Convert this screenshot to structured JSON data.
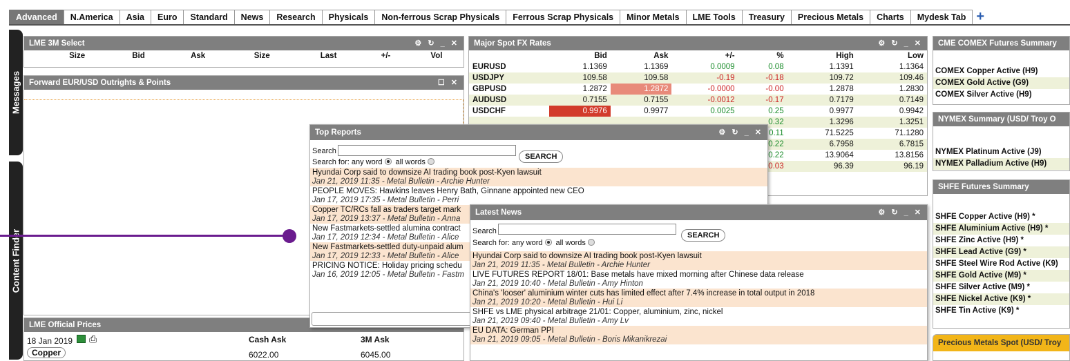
{
  "tabs": [
    "Advanced",
    "N.America",
    "Asia",
    "Euro",
    "Standard",
    "News",
    "Research",
    "Physicals",
    "Non-ferrous Scrap Physicals",
    "Ferrous Scrap Physicals",
    "Minor Metals",
    "LME Tools",
    "Treasury",
    "Precious Metals",
    "Charts",
    "Mydesk Tab"
  ],
  "tab_add": "+",
  "sidebar": {
    "messages": "Messages",
    "content_finder": "Content Finder"
  },
  "lme3m": {
    "title": "LME 3M Select",
    "columns": [
      "Size",
      "Bid",
      "Ask",
      "Size",
      "Last",
      "+/-",
      "Vol"
    ]
  },
  "forward": {
    "title": "Forward EUR/USD Outrights & Points"
  },
  "official": {
    "title": "LME Official Prices",
    "date": "18 Jan 2019",
    "col_cash": "Cash Ask",
    "col_3m": "3M Ask",
    "row_metal": "Copper",
    "row_cash": "6022.00",
    "row_3m": "6045.00"
  },
  "fx": {
    "title": "Major Spot FX Rates",
    "headers": [
      "",
      "Bid",
      "Ask",
      "+/-",
      "%",
      "High",
      "Low"
    ],
    "rows": [
      [
        "EURUSD",
        "1.1369",
        "1.1369",
        "0.0009",
        "0.08",
        "1.1391",
        "1.1364"
      ],
      [
        "USDJPY",
        "109.58",
        "109.58",
        "-0.19",
        "-0.18",
        "109.72",
        "109.46"
      ],
      [
        "GBPUSD",
        "1.2872",
        "1.2872",
        "-0.0000",
        "-0.00",
        "1.2878",
        "1.2830"
      ],
      [
        "AUDUSD",
        "0.7155",
        "0.7155",
        "-0.0012",
        "-0.17",
        "0.7179",
        "0.7149"
      ],
      [
        "USDCHF",
        "0.9976",
        "0.9977",
        "0.0025",
        "0.25",
        "0.9977",
        "0.9942"
      ],
      [
        "",
        "",
        "",
        "",
        "0.32",
        "1.3296",
        "1.3251"
      ],
      [
        "",
        "",
        "",
        "",
        "0.11",
        "71.5225",
        "71.1280"
      ],
      [
        "",
        "",
        "",
        "",
        "0.22",
        "6.7958",
        "6.7815"
      ],
      [
        "",
        "",
        "",
        "",
        "0.22",
        "13.9064",
        "13.8156"
      ],
      [
        "",
        "",
        "",
        "",
        "-0.03",
        "96.39",
        "96.19"
      ]
    ]
  },
  "comex": {
    "title": "CME COMEX Futures Summary",
    "items": [
      "COMEX Copper Active (H9)",
      "COMEX Gold Active (G9)",
      "COMEX Silver Active (H9)"
    ]
  },
  "nymex": {
    "title": "NYMEX Summary (USD/ Troy O",
    "items": [
      "NYMEX Platinum Active (J9)",
      "NYMEX Palladium Active (H9)"
    ]
  },
  "shfe": {
    "title": "SHFE Futures Summary",
    "items": [
      "SHFE Copper Active (H9) *",
      "SHFE Aluminium Active (H9) *",
      "SHFE Zinc Active (H9) *",
      "SHFE Lead Active (G9) *",
      "SHFE Steel Wire Rod Active (K9)",
      "SHFE Gold Active (M9) *",
      "SHFE Silver Active (M9) *",
      "SHFE Nickel Active (K9) *",
      "SHFE Tin Active (K9) *"
    ]
  },
  "precious": {
    "title": "Precious Metals Spot (USD/ Troy"
  },
  "top_reports": {
    "title": "Top Reports",
    "search_label": "Search",
    "search_for": "Search for: any word",
    "all_words": "all words",
    "search_button": "SEARCH",
    "items": [
      {
        "headline": "Hyundai Corp said to downsize AI trading book post-Kyen lawsuit",
        "meta": "Jan 21, 2019 11:35 - Metal Bulletin - Archie Hunter"
      },
      {
        "headline": "PEOPLE MOVES: Hawkins leaves Henry Bath, Ginnane appointed new CEO",
        "meta": "Jan 17, 2019 17:35 - Metal Bulletin - Perri"
      },
      {
        "headline": "Copper TC/RCs fall as traders target mark",
        "meta": "Jan 17, 2019 13:37 - Metal Bulletin - Anna"
      },
      {
        "headline": "New Fastmarkets-settled alumina contract",
        "meta": "Jan 17, 2019 12:34 - Metal Bulletin - Alice"
      },
      {
        "headline": "New Fastmarkets-settled duty-unpaid alum",
        "meta": "Jan 17, 2019 12:33 - Metal Bulletin - Alice"
      },
      {
        "headline": "PRICING NOTICE: Holiday pricing schedu",
        "meta": "Jan 16, 2019 12:05 - Metal Bulletin - Fastm"
      }
    ]
  },
  "latest_news": {
    "title": "Latest News",
    "search_label": "Search",
    "search_for": "Search for: any word",
    "all_words": "all words",
    "search_button": "SEARCH",
    "items": [
      {
        "headline": "Hyundai Corp said to downsize AI trading book post-Kyen lawsuit",
        "meta": "Jan 21, 2019 11:35 - Metal Bulletin - Archie Hunter"
      },
      {
        "headline": "LIVE FUTURES REPORT 18/01: Base metals have mixed morning after Chinese data release",
        "meta": "Jan 21, 2019 10:40 - Metal Bulletin - Amy Hinton"
      },
      {
        "headline": "China's 'looser' aluminium winter cuts has limited effect after 7.4% increase in total output in 2018",
        "meta": "Jan 21, 2019 10:20 - Metal Bulletin - Hui Li"
      },
      {
        "headline": "SHFE vs LME physical arbitrage 21/01: Copper, aluminium, zinc, nickel",
        "meta": "Jan 21, 2019 09:40 - Metal Bulletin - Amy Lv"
      },
      {
        "headline": "EU DATA: German PPI",
        "meta": "Jan 21, 2019 09:05 - Metal Bulletin - Boris Mikanikrezai"
      }
    ]
  },
  "panel_controls": "⚙ ↻ _ ✕",
  "colors": {
    "header": "#7f7f7f",
    "accent": "#6a1b8e",
    "alt_row": "#eef1d9",
    "news_alt": "#fbe4cf",
    "gold_header": "#f2b518"
  }
}
